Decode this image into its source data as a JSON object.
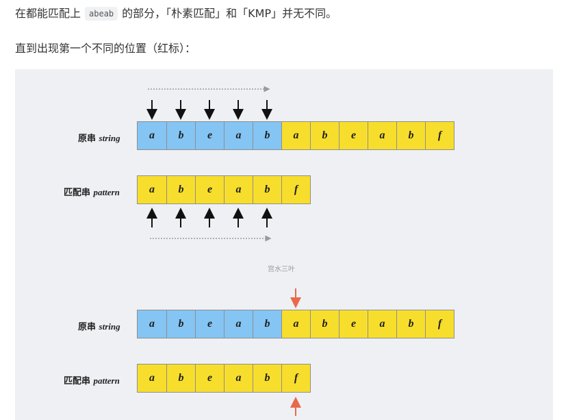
{
  "intro": {
    "sentence_part1": "在都能匹配上",
    "code": "abeab",
    "sentence_part2": "的部分，「朴素匹配」和「KMP」并无不同。",
    "second_line": "直到出现第一个不同的位置（红标）："
  },
  "figure": {
    "top_panel": {
      "string_label_cn": "原串",
      "string_label_en": "string",
      "pattern_label_cn": "匹配串",
      "pattern_label_en": "pattern",
      "string_chars": [
        "a",
        "b",
        "e",
        "a",
        "b",
        "a",
        "b",
        "e",
        "a",
        "b",
        "f"
      ],
      "string_blue_count": 5,
      "pattern_chars": [
        "a",
        "b",
        "e",
        "a",
        "b",
        "f"
      ],
      "arrow_count": 5
    },
    "watermark": "宫水三叶",
    "bottom_panel": {
      "string_label_cn": "原串",
      "string_label_en": "string",
      "pattern_label_cn": "匹配串",
      "pattern_label_en": "pattern",
      "string_chars": [
        "a",
        "b",
        "e",
        "a",
        "b",
        "a",
        "b",
        "e",
        "a",
        "b",
        "f"
      ],
      "string_blue_count": 5,
      "pattern_chars": [
        "a",
        "b",
        "e",
        "a",
        "b",
        "f"
      ],
      "mismatch_index": 5
    },
    "colors": {
      "blue": "#84c5f4",
      "yellow": "#f8de2c",
      "red_arrow": "#e8694a",
      "background": "#eff0f4"
    }
  }
}
